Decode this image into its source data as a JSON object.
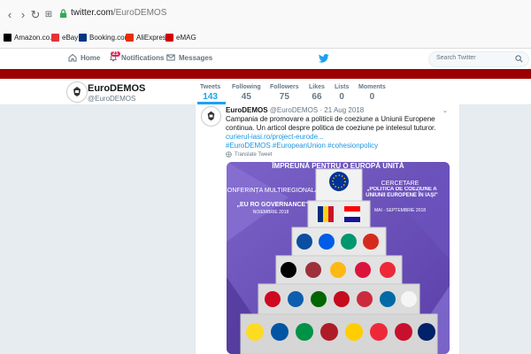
{
  "browser": {
    "url_host": "twitter.com",
    "url_path": "/EuroDEMOS",
    "bookmarks": [
      {
        "label": "Amazon.co.uk",
        "icon": "amazon-icon",
        "color": "#000000"
      },
      {
        "label": "eBay",
        "icon": "ebay-icon",
        "color": "#e53238"
      },
      {
        "label": "Booking.com",
        "icon": "booking-icon",
        "color": "#003580"
      },
      {
        "label": "AliExpress",
        "icon": "aliexpress-icon",
        "color": "#e62e04"
      },
      {
        "label": "eMAG",
        "icon": "emag-icon",
        "color": "#d10000"
      }
    ]
  },
  "twitter_nav": {
    "home": "Home",
    "notifications": "Notifications",
    "notifications_count": "21",
    "messages": "Messages",
    "search_placeholder": "Search Twitter",
    "brand_color": "#1da1f2"
  },
  "banner_color": "#9b0000",
  "profile": {
    "name": "EuroDEMOS",
    "handle": "@EuroDEMOS",
    "stats": [
      {
        "label": "Tweets",
        "value": "143",
        "active": true
      },
      {
        "label": "Following",
        "value": "45",
        "active": false
      },
      {
        "label": "Followers",
        "value": "75",
        "active": false
      },
      {
        "label": "Likes",
        "value": "66",
        "active": false
      },
      {
        "label": "Lists",
        "value": "0",
        "active": false
      },
      {
        "label": "Moments",
        "value": "0",
        "active": false
      }
    ]
  },
  "tweet": {
    "name": "EuroDEMOS",
    "handle": "@EuroDEMOS",
    "date": "· 21 Aug 2018",
    "text": "Campania de promovare a politicii de coeziune a Uniunii Europene continua. Un articol despre politica de coeziune pe intelesul tuturor.",
    "link": "curierul-iasi.ro/project-eurode...",
    "hashtags": "#EuroDEMOS #EuropeanUnion #cohesionpolicy",
    "translate": "Translate Tweet",
    "media": {
      "left_title": "CONFERINȚA MULTIREGIONALĂ",
      "left_subtitle": "„EU RO GOVERNANCE\"",
      "left_date": "NOIEMBRIE 2018",
      "right_title": "CERCETARE",
      "right_subtitle": "„POLITICA DE COEZIUNE A UNIUNII EUROPENE ÎN IAȘI\"",
      "right_date": "MAI - SEPTEMBRIE 2018",
      "top_text": "ÎMPREUNĂ PENTRU O EUROPĂ UNITĂ"
    }
  }
}
